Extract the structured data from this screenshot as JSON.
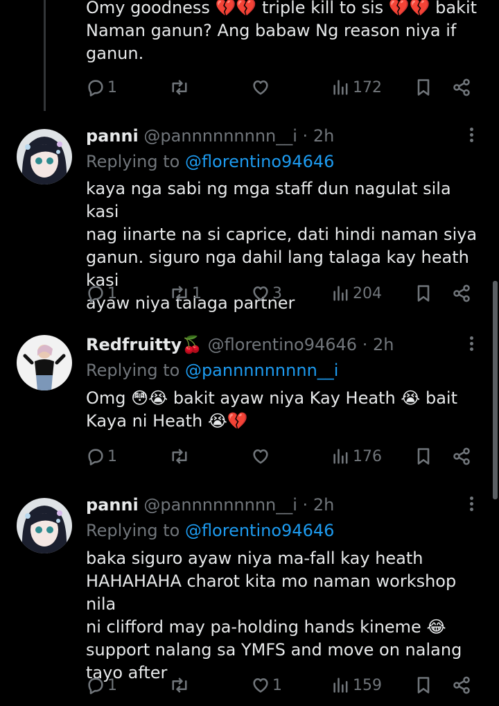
{
  "top_tweet": {
    "text": "Omy goodness 💔💔 triple kill to sis 💔💔 bakit\nNaman ganun? Ang babaw Ng reason niya if\nganun.",
    "replies": "1",
    "reposts": "",
    "likes": "",
    "views": "172"
  },
  "tweets": [
    {
      "name": "panni",
      "handle": "@pannnnnnnnn__i · 2h",
      "replying_prefix": "Replying to ",
      "replying_to": "@florentino94646",
      "text": "kaya nga sabi ng mga staff dun nagulat sila kasi\nnag iinarte na si caprice, dati hindi naman siya\nganun. siguro nga dahil lang talaga kay heath kasi\nayaw niya talaga partner",
      "replies": "1",
      "reposts": "1",
      "likes": "3",
      "views": "204"
    },
    {
      "name": "Redfruitty🍒",
      "handle": "@florentino94646 · 2h",
      "replying_prefix": "Replying to ",
      "replying_to": "@pannnnnnnnn__i",
      "text": "Omg 😳😭 bakit ayaw niya Kay Heath 😭 bait\nKaya ni Heath 😭💔",
      "replies": "1",
      "reposts": "",
      "likes": "",
      "views": "176"
    },
    {
      "name": "panni",
      "handle": "@pannnnnnnnn__i · 2h",
      "replying_prefix": "Replying to ",
      "replying_to": "@florentino94646",
      "text": "baka siguro ayaw niya ma-fall kay heath\nHAHAHAHA charot kita mo naman workshop nila\nni clifford may pa-holding hands kineme 😂\nsupport nalang sa YMFS and move on nalang\ntayo after",
      "replies": "1",
      "reposts": "",
      "likes": "1",
      "views": "159"
    }
  ]
}
